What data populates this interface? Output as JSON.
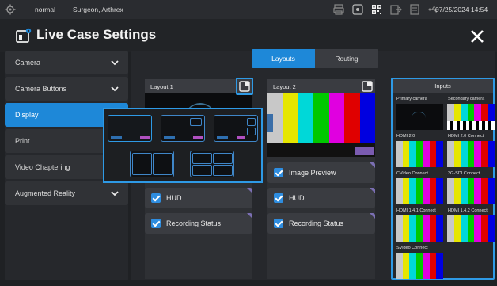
{
  "status": {
    "mode": "normal",
    "user": "Surgeon, Arthrex",
    "datetime": "07/25/2024 14:54",
    "icons": [
      "printer-icon",
      "record-icon",
      "qr-code-icon",
      "export-icon",
      "storage-icon",
      "usb-icon"
    ]
  },
  "title": "Live Case Settings",
  "sidebar": {
    "items": [
      {
        "label": "Camera",
        "has_chevron": true
      },
      {
        "label": "Camera Buttons",
        "has_chevron": true
      },
      {
        "label": "Display",
        "has_chevron": false,
        "active": true
      },
      {
        "label": "Print",
        "has_chevron": false
      },
      {
        "label": "Video Chaptering",
        "has_chevron": false
      },
      {
        "label": "Augmented Reality",
        "has_chevron": true
      }
    ]
  },
  "tabs": {
    "layouts": "Layouts",
    "routing": "Routing",
    "active": "Layouts"
  },
  "layout1": {
    "title": "Layout 1",
    "options": [
      {
        "label": "HUD",
        "checked": true
      },
      {
        "label": "Recording Status",
        "checked": true
      }
    ]
  },
  "layout2": {
    "title": "Layout 2",
    "options": [
      {
        "label": "Image Preview",
        "checked": true
      },
      {
        "label": "HUD",
        "checked": true
      },
      {
        "label": "Recording Status",
        "checked": true
      }
    ]
  },
  "inputs": {
    "title": "Inputs",
    "sources": [
      "Primary camera",
      "Secondary camera",
      "HDMI 2.0",
      "HDMI 2.0 Connect",
      "CVideo Connect",
      "3G-SDI Connect",
      "HDMI 1.4.1 Connect",
      "HDMI 1.4.2 Connect",
      "SVideo Connect"
    ]
  },
  "colors": {
    "accent": "#1e88d8",
    "highlight": "#2e9ae6",
    "bars": [
      "#c8c8c8",
      "#e6e600",
      "#00d8d8",
      "#00c800",
      "#e000e0",
      "#e00000",
      "#0000e0"
    ]
  }
}
